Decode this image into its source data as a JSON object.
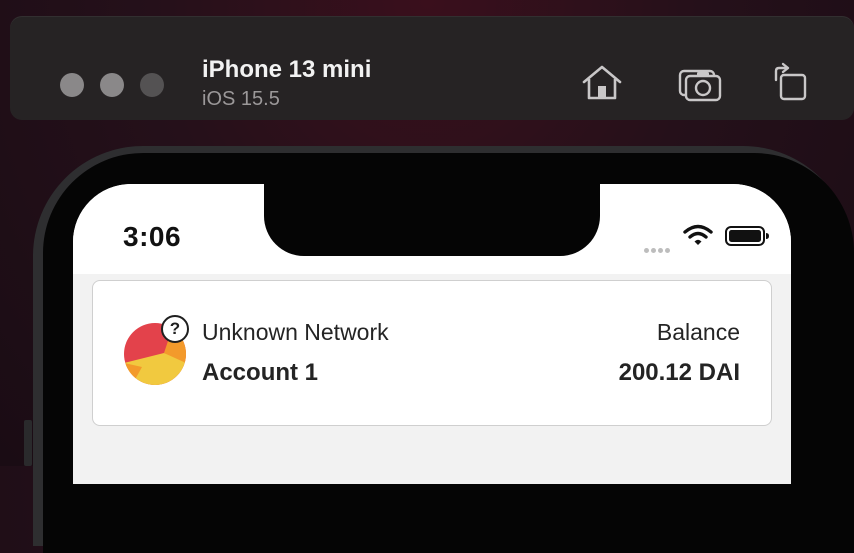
{
  "simulator": {
    "device_name": "iPhone 13 mini",
    "os_version": "iOS 15.5",
    "icons": [
      "home-icon",
      "screenshot-icon",
      "rotate-icon"
    ]
  },
  "statusbar": {
    "time": "3:06"
  },
  "account_card": {
    "network_label": "Unknown Network",
    "account_name": "Account 1",
    "balance_label": "Balance",
    "balance_value": "200.12 DAI",
    "help_symbol": "?"
  },
  "colors": {
    "avatar_red": "#e3424b",
    "avatar_yellow": "#f1c93f",
    "avatar_orange": "#f39a2b"
  }
}
